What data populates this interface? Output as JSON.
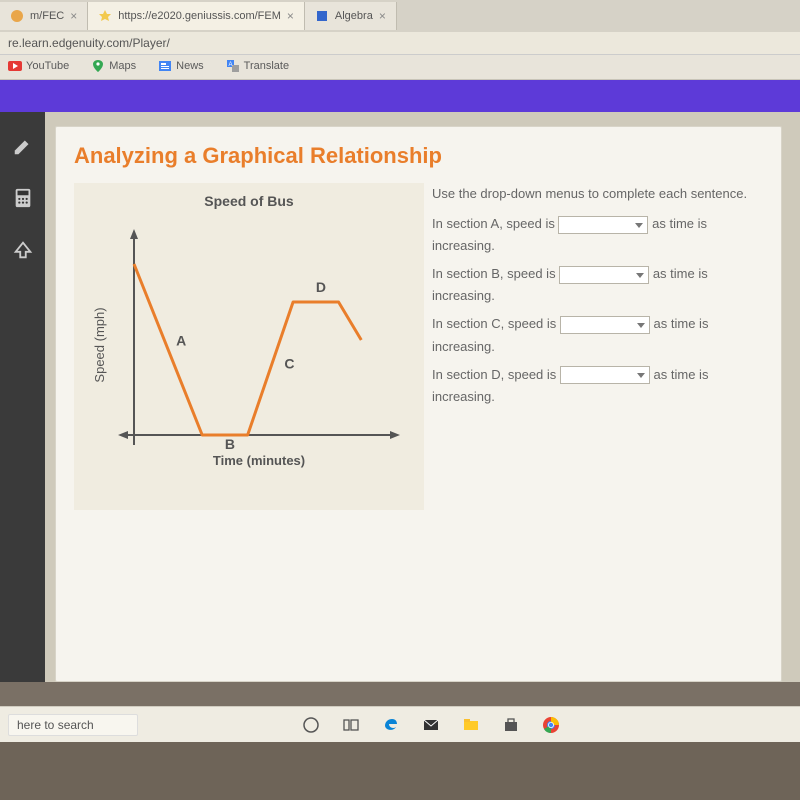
{
  "browser": {
    "tabs": [
      {
        "label": "m/FEC",
        "favicon_color": "#e9a64a"
      },
      {
        "label": "https://e2020.geniussis.com/FEM",
        "favicon_color": "#f2c94c"
      },
      {
        "label": "Algebra",
        "favicon_color": "#3366cc"
      }
    ],
    "address": "re.learn.edgenuity.com/Player/",
    "bookmarks": [
      {
        "label": "YouTube",
        "icon": "youtube"
      },
      {
        "label": "Maps",
        "icon": "maps"
      },
      {
        "label": "News",
        "icon": "news"
      },
      {
        "label": "Translate",
        "icon": "translate"
      }
    ]
  },
  "lesson": {
    "title": "Analyzing a Graphical Relationship",
    "chart_title": "Speed of Bus",
    "prompt": "Use the drop-down menus to complete each sentence.",
    "statements": [
      {
        "pre": "In section A, speed is",
        "post": "as time is increasing."
      },
      {
        "pre": "In section B, speed is",
        "post": "as time is increasing."
      },
      {
        "pre": "In section C, speed is",
        "post": "as time is increasing."
      },
      {
        "pre": "In section D, speed is",
        "post": "as time is increasing."
      }
    ]
  },
  "chart_data": {
    "type": "line",
    "title": "Speed of Bus",
    "xlabel": "Time (minutes)",
    "ylabel": "Speed (mph)",
    "x": [
      0,
      3,
      5,
      7,
      9,
      10
    ],
    "values": [
      9,
      0,
      0,
      7,
      7,
      5
    ],
    "segment_labels": [
      "A",
      "B",
      "C",
      "D"
    ],
    "xlim": [
      0,
      11
    ],
    "ylim": [
      0,
      10
    ]
  },
  "taskbar": {
    "search_placeholder": "here to search"
  }
}
